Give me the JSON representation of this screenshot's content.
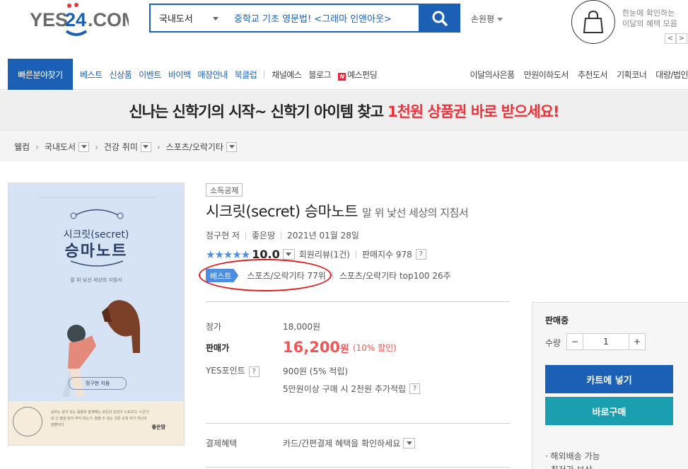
{
  "header": {
    "logo_text": "YES24.COM",
    "search_category": "국내도서",
    "search_query": "중학교 기초 영문법! <그래마 인앤아웃>",
    "user_label": "손원평",
    "promo_text_line1": "한눈에 확인하는",
    "promo_text_line2": "이달의 혜택 모음",
    "prev": "<",
    "next": ">"
  },
  "nav": {
    "quick": "빠른분야찾기",
    "left": [
      "베스트",
      "신상품",
      "이벤트",
      "바이백",
      "매장안내",
      "북클럽"
    ],
    "left2": [
      "채널예스",
      "블로그"
    ],
    "funding_badge": "N",
    "funding": "예스펀딩",
    "right": [
      "이달의사은품",
      "만원이하도서",
      "추천도서",
      "기획코너",
      "대량/법인"
    ]
  },
  "banner": {
    "text": "신나는 신학기의 시작~ 신학기 아이템 찾고",
    "highlight": "1천원 상품권 바로 받으세요!"
  },
  "breadcrumb": [
    "웰컴",
    "국내도서",
    "건강 취미",
    "스포츠/오락기타"
  ],
  "cover": {
    "title_small": "시크릿(secret)",
    "title_big": "승마노트",
    "subtitle": "말 위 낯선 세상의 지침서",
    "author": "정구현 지음",
    "publisher": "좋은땅",
    "blurb": "승마는 살아 있는 동물과 함께해는 모든의 감성이 스포츠다. 누군가 내 신 말을 탔어 주어 되는가. 말을 수 있는 것은 오직 자기 자신의 말뿐이다."
  },
  "product": {
    "tag": "소득공제",
    "title": "시크릿(secret) 승마노트",
    "subtitle": "말 위 낯선 세상의 지침서",
    "author": "정구현 저",
    "publisher": "좋은땅",
    "date": "2021년 01월 28일",
    "stars": "★★★★★",
    "score": "10.0",
    "reviews": "회원리뷰(1건)",
    "sales_index": "판매지수 978",
    "best_badge": "베스트",
    "best_rank": "스포츠/오락기타 77위",
    "top100": "스포츠/오락기타 top100 26주"
  },
  "price": {
    "list_label": "정가",
    "list_value": "18,000원",
    "sale_label": "판매가",
    "sale_value": "16,200",
    "sale_unit": "원",
    "discount": "(10% 할인)",
    "point_label": "YES포인트",
    "point_value": "900원 (5% 적립)",
    "extra_point": "5만원이상 구매 시 2천원 추가적립",
    "card_label": "결제혜택",
    "card_value": "카드/간편결제 혜택을 확인하세요",
    "help": "?"
  },
  "buy": {
    "state": "판매중",
    "qty_label": "수량",
    "minus": "−",
    "qty": "1",
    "plus": "+",
    "cart": "카트에 넣기",
    "buy_now": "바로구매",
    "overseas": "· 해외배송 가능",
    "more": "· 최저가 보상"
  }
}
